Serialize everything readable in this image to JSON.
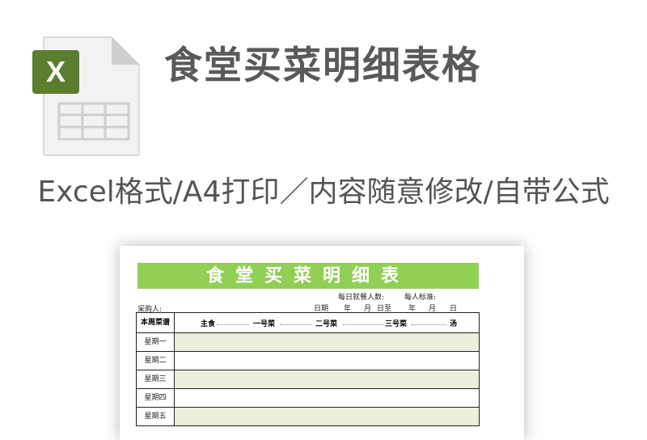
{
  "header": {
    "file_icon_glyph": "X",
    "title": "食堂买菜明细表格",
    "subtitle": "Excel格式/A4打印／内容随意修改/自带公式"
  },
  "sheet": {
    "banner_title": "食堂买菜明细表",
    "daily_diners_label": "每日就餐人数:",
    "per_person_label": "每人标准:",
    "buyer_label": "采购人:",
    "date_label": "日期",
    "year_label_1": "年",
    "month_label_1": "月",
    "day_to_label": "日至",
    "year_label_2": "年",
    "month_label_2": "月",
    "day_label_2": "日",
    "header_first": "本周菜谱",
    "columns": [
      "主食",
      "一号菜",
      "二号菜",
      "三号菜",
      "汤"
    ],
    "days": [
      "星期一",
      "星期二",
      "星期三",
      "星期四",
      "星期五"
    ]
  },
  "colors": {
    "excel_green": "#5b7d2e",
    "banner_green": "#92cf55",
    "row_shade": "#ebf0dd",
    "title_gray": "#5a5a5a"
  }
}
